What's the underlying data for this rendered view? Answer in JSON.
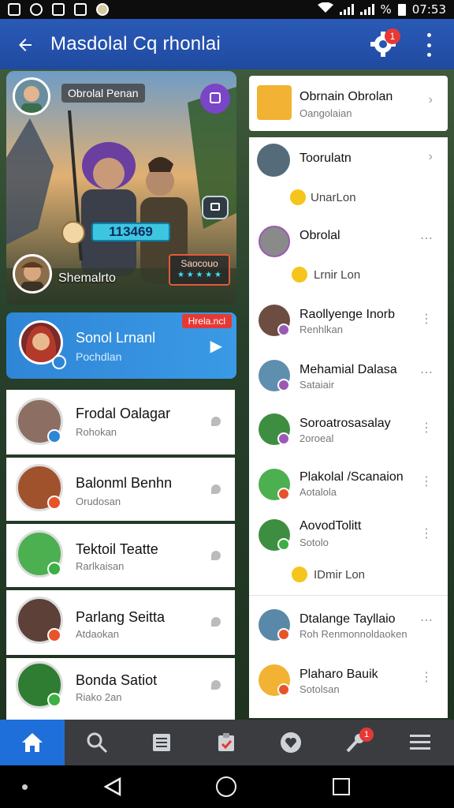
{
  "status_bar": {
    "time": "07:53",
    "battery": "%"
  },
  "app_bar": {
    "title": "Masdolal Cq rhonlai",
    "notification_count": "1"
  },
  "hero": {
    "top_label": "Obrolal Penan",
    "bottom_name": "Shemalrto",
    "score": "113469",
    "tag_line_1": "Saocouo",
    "tag_line_2": "★ ★ ★ ★ ★"
  },
  "selected_card": {
    "name": "Sonol Lrnanl",
    "subtitle": "Pochdlan",
    "badge": "Hrela.ncl"
  },
  "left_list": [
    {
      "name": "Frodal Oalagar",
      "subtitle": "Rohokan",
      "status_color": "#2f86d6",
      "avatar_bg": "#8d6e63"
    },
    {
      "name": "Balonml Benhn",
      "subtitle": "Orudosan",
      "status_color": "#e8542a",
      "avatar_bg": "#a0522d"
    },
    {
      "name": "Tektoil Teatte",
      "subtitle": "Rarlkaisan",
      "status_color": "#3cb043",
      "avatar_bg": "#4caf50"
    },
    {
      "name": "Parlang Seitta",
      "subtitle": "Atdaokan",
      "status_color": "#e8542a",
      "avatar_bg": "#5d4037"
    },
    {
      "name": "Bonda Satiot",
      "subtitle": "Riako 2an",
      "status_color": "#3cb043",
      "avatar_bg": "#2e7d32"
    }
  ],
  "right_top": [
    {
      "name": "Obrnain Obrolan",
      "subtitle": "Oangolaian"
    },
    {
      "name": "Toorulatn",
      "subtitle": "UnarLon"
    }
  ],
  "right_list": [
    {
      "name": "Obrolal",
      "subtitle": "Lrnir Lon",
      "emoji_row": true
    },
    {
      "name": "Raollyenge Inorb",
      "subtitle": "Renhlkan"
    },
    {
      "name": "Mehamial Dalasa",
      "subtitle": "Sataiair"
    },
    {
      "name": "Soroatrosasalay",
      "subtitle": "2oroeal"
    },
    {
      "name": "Plakolal /Scanaion",
      "subtitle": "Aotalola"
    },
    {
      "name": "AovodTolitt",
      "subtitle": "Sotolo",
      "footer": "IDmir Lon"
    },
    {
      "name": "Dtalange Tayllaio",
      "subtitle": "Roh Renmonnoldaoken"
    },
    {
      "name": "Plaharo Bauik",
      "subtitle": "Sotolsan"
    }
  ],
  "bottom_nav": {
    "tabs": [
      "home",
      "search",
      "list",
      "clipboard",
      "heart",
      "microphone",
      "menu"
    ],
    "badge": "1"
  },
  "icons": {
    "back": "arrow-left-icon",
    "gear": "gear-icon",
    "more": "more-vert-icon"
  }
}
